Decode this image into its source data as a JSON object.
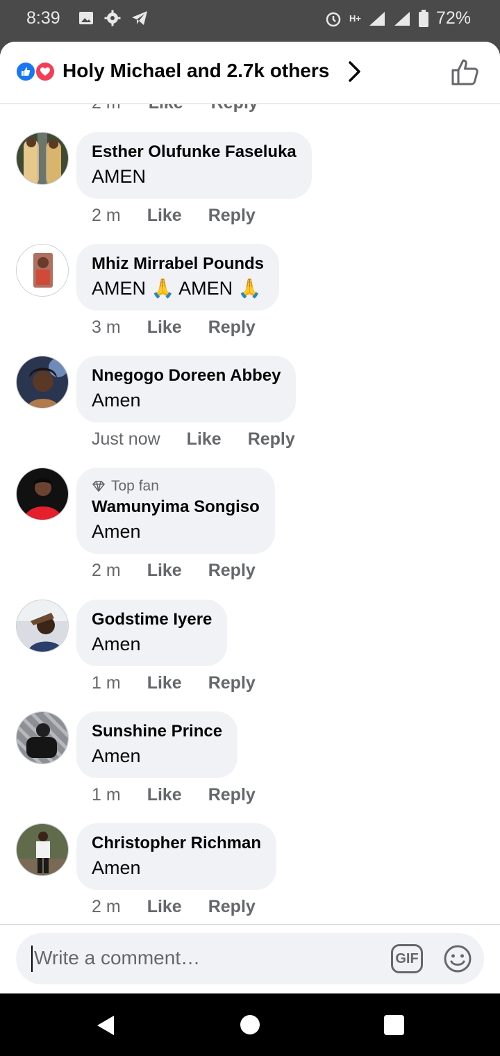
{
  "status_bar": {
    "time": "8:39",
    "network": "H+",
    "battery": "72%"
  },
  "header": {
    "reactions_text": "Holy Michael and 2.7k others"
  },
  "partial_row": {
    "time": "2 m",
    "like": "Like",
    "reply": "Reply"
  },
  "comments": [
    {
      "author": "Esther Olufunke Faseluka",
      "text": "AMEN",
      "time": "2 m",
      "like": "Like",
      "reply": "Reply"
    },
    {
      "author": "Mhiz Mirrabel Pounds",
      "text": "AMEN 🙏 AMEN 🙏",
      "time": "3 m",
      "like": "Like",
      "reply": "Reply"
    },
    {
      "author": "Nnegogo Doreen Abbey",
      "text": "Amen",
      "time": "Just now",
      "like": "Like",
      "reply": "Reply"
    },
    {
      "author": "Wamunyima Songiso",
      "badge": "Top fan",
      "text": "Amen",
      "time": "2 m",
      "like": "Like",
      "reply": "Reply"
    },
    {
      "author": "Godstime Iyere",
      "text": "Amen",
      "time": "1 m",
      "like": "Like",
      "reply": "Reply"
    },
    {
      "author": "Sunshine Prince",
      "text": "Amen",
      "time": "1 m",
      "like": "Like",
      "reply": "Reply"
    },
    {
      "author": "Christopher Richman",
      "text": "Amen",
      "time": "2 m",
      "like": "Like",
      "reply": "Reply"
    }
  ],
  "composer": {
    "placeholder": "Write a comment…",
    "gif_label": "GIF"
  },
  "colors": {
    "brand_blue": "#1877f2",
    "love_red": "#f33e58",
    "bubble_bg": "#f0f2f5",
    "secondary_text": "#65676b"
  },
  "icons": [
    "image-icon",
    "gear-icon",
    "telegram-icon",
    "alarm-icon",
    "signal-icon",
    "battery-icon",
    "like-reaction-icon",
    "love-reaction-icon",
    "chevron-right-icon",
    "thumbs-up-icon",
    "diamond-icon",
    "gif-icon",
    "smiley-icon",
    "back-icon",
    "home-icon",
    "recents-icon"
  ]
}
